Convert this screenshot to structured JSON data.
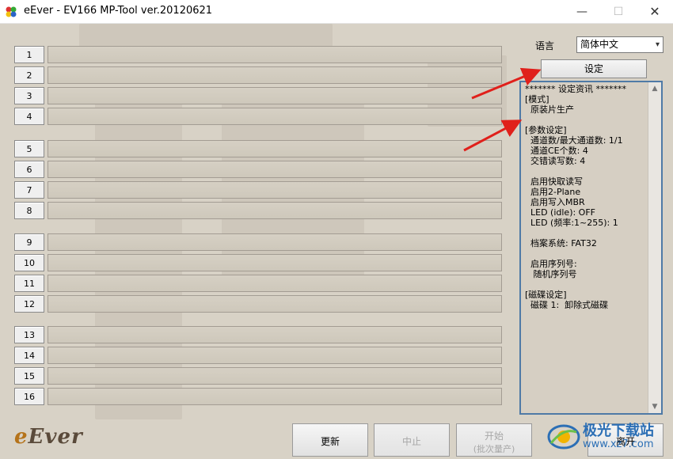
{
  "window": {
    "title": "eEver - EV166 MP-Tool ver.20120621",
    "min_label": "—",
    "max_label": "☐",
    "close_label": "✕"
  },
  "ports": [
    "1",
    "2",
    "3",
    "4",
    "5",
    "6",
    "7",
    "8",
    "9",
    "10",
    "11",
    "12",
    "13",
    "14",
    "15",
    "16"
  ],
  "language": {
    "label": "语言",
    "value": "简体中文"
  },
  "settings_button": "设定",
  "info_lines": [
    "******* 设定资讯 *******",
    "[模式]",
    "  原装片生产",
    "",
    "[参数设定]",
    "  通道数/最大通道数: 1/1",
    "  通道CE个数: 4",
    "  交错读写数: 4",
    "",
    "  启用快取读写",
    "  启用2-Plane",
    "  启用写入MBR",
    "  LED (idle): OFF",
    "  LED (频率:1~255): 1",
    "",
    "  档案系统: FAT32",
    "",
    "  启用序列号:",
    "   随机序列号",
    "",
    "[磁碟设定]",
    "  磁碟 1:  卸除式磁碟"
  ],
  "logo": {
    "prefix": "e",
    "rest": "Ever"
  },
  "bottom_buttons": {
    "refresh": "更新",
    "stop": "中止",
    "start_l1": "开始",
    "start_l2": "(批次量产)",
    "exit": "离开"
  },
  "watermark": {
    "main": "极光下载站",
    "sub": "www.xz7.com"
  },
  "colors": {
    "client_bg": "#d8d2c6",
    "panel_border": "#4f7aa6",
    "arrow": "#e0201b"
  }
}
